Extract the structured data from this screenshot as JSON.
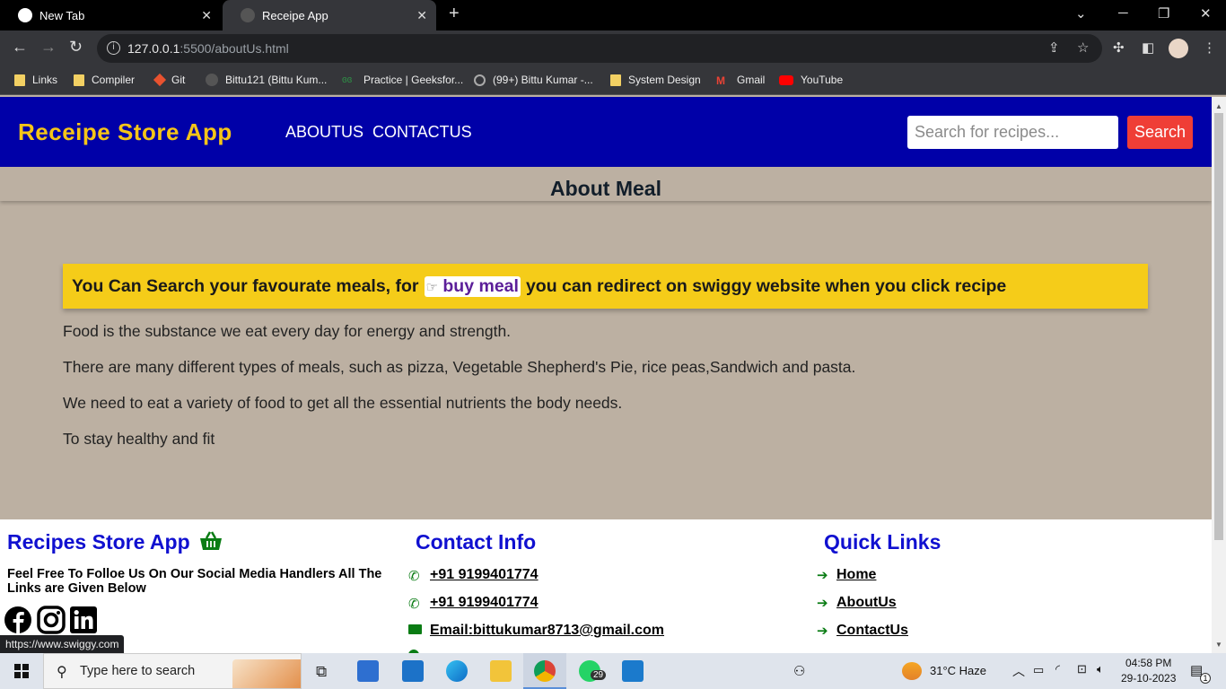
{
  "browser": {
    "tabs": [
      {
        "title": "New Tab"
      },
      {
        "title": "Receipe App"
      }
    ],
    "url": {
      "host": "127.0.0.1",
      "path": ":5500/aboutUs.html"
    },
    "bookmarks": [
      "Links",
      "Compiler",
      "Git",
      "Bittu121 (Bittu Kum...",
      "Practice | Geeksfor...",
      "(99+) Bittu Kumar -...",
      "System Design",
      "Gmail",
      "YouTube"
    ],
    "status_url": "https://www.swiggy.com"
  },
  "header": {
    "brand": "Receipe Store App",
    "nav": [
      "ABOUTUS",
      "CONTACTUS"
    ],
    "search_placeholder": "Search for recipes...",
    "search_label": "Search"
  },
  "about": {
    "title": "About Meal",
    "banner_before": "You Can Search your favourate meals, for",
    "banner_link": "buy meal",
    "banner_after": "you can redirect on swiggy website when you click recipe",
    "paragraphs": [
      "Food is the substance we eat every day for energy and strength.",
      "There are many different types of meals, such as pizza, Vegetable Shepherd's Pie, rice peas,Sandwich and pasta.",
      "We need to eat a variety of food to get all the essential nutrients the body needs.",
      "To stay healthy and fit"
    ]
  },
  "footer": {
    "brand_title": "Recipes Store App",
    "follow_text": "Feel Free To Folloe Us On Our Social Media Handlers All The Links are Given Below",
    "contact_title": "Contact Info",
    "contacts": [
      "+91 9199401774",
      "+91 9199401774",
      "Email:bittukumar8713@gmail.com"
    ],
    "quick_title": "Quick Links",
    "quick_links": [
      "Home",
      "AboutUs",
      "ContactUs"
    ]
  },
  "taskbar": {
    "search_placeholder": "Type here to search",
    "weather": "31°C  Haze",
    "time": "04:58 PM",
    "date": "29-10-2023",
    "whatsapp_badge": "29",
    "notif_badge": "1"
  },
  "colors": {
    "header_bg": "#0000a8",
    "brand": "#f5c518",
    "page_bg": "#bcb0a2",
    "banner_bg": "#f5cc19",
    "search_btn": "#ef3e36",
    "footer_heading": "#1010d0",
    "footer_icon": "#0a7c14"
  }
}
